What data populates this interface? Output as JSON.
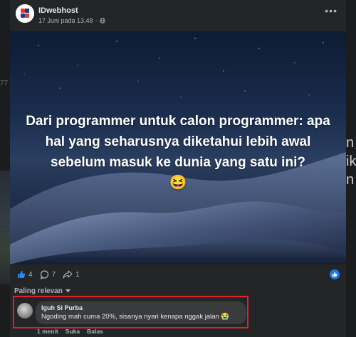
{
  "background": {
    "left_fragment": "77",
    "right_fragment": "n\nik\nn"
  },
  "post": {
    "page_name": "IDwebhost",
    "timestamp": "17 Juni pada 13.48",
    "privacy_icon": "globe-icon",
    "menu_icon": "more-dots-icon",
    "image_text": "Dari programmer untuk calon programmer: apa hal yang seharusnya diketahui lebih awal sebelum masuk ke dunia yang satu ini?",
    "image_emoji": "😆",
    "accent_color": "#1877f2"
  },
  "stats": {
    "likes": "4",
    "comments": "7",
    "shares": "1"
  },
  "comments_section": {
    "sort_label": "Paling relevan",
    "highlight_color": "#e0202a",
    "comment": {
      "author": "Iguh Si Purba",
      "text": "Ngoding mah cuma 20%, sisanya nyari kenapa nggak jalan 😭",
      "time": "1 menit",
      "like_label": "Suka",
      "reply_label": "Balas"
    }
  }
}
